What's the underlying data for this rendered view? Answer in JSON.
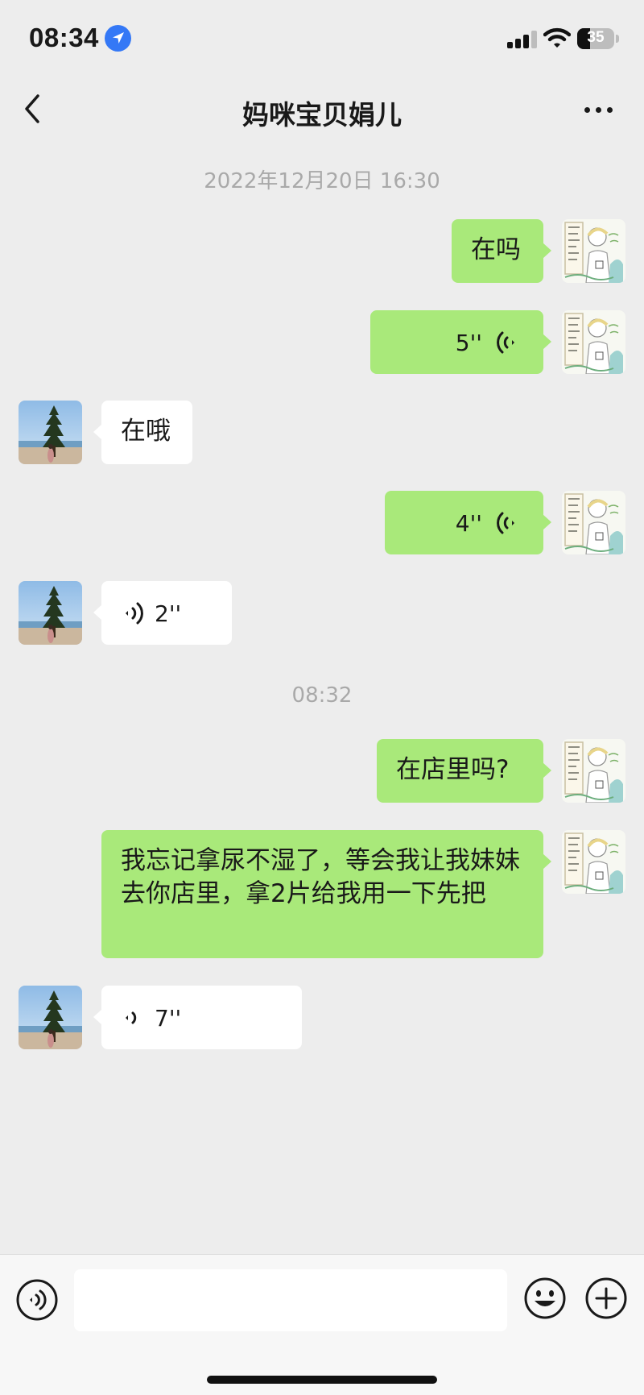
{
  "status_bar": {
    "time": "08:34",
    "battery_level": "35",
    "location_icon": "location-arrow-icon",
    "signal_icon": "cellular-signal-icon",
    "wifi_icon": "wifi-icon",
    "battery_icon": "battery-icon"
  },
  "nav": {
    "title": "妈咪宝贝娟儿",
    "back_icon": "chevron-left-icon",
    "more_icon": "more-dots-icon"
  },
  "chat": {
    "timestamps": [
      "2022年12月20日 16:30",
      "08:32"
    ],
    "messages": [
      {
        "sender": "me",
        "type": "text",
        "text": "在吗"
      },
      {
        "sender": "me",
        "type": "voice",
        "duration": "5''"
      },
      {
        "sender": "them",
        "type": "text",
        "text": "在哦"
      },
      {
        "sender": "me",
        "type": "voice",
        "duration": "4''"
      },
      {
        "sender": "them",
        "type": "voice",
        "duration": "2''"
      },
      {
        "sender": "me",
        "type": "text",
        "text": "在店里吗?"
      },
      {
        "sender": "me",
        "type": "text",
        "text": "我忘记拿尿不湿了，等会我让我妹妹去你店里，拿2片给我用一下先把"
      },
      {
        "sender": "them",
        "type": "voice",
        "duration": "7''"
      }
    ]
  },
  "input_bar": {
    "voice_icon": "voice-input-icon",
    "emoji_icon": "emoji-icon",
    "add_icon": "plus-circle-icon",
    "input_value": ""
  },
  "colors": {
    "background": "#ededed",
    "my_bubble": "#a9e97a",
    "their_bubble": "#ffffff",
    "timestamp": "#a9a9a9",
    "location_accent": "#3478f6"
  }
}
